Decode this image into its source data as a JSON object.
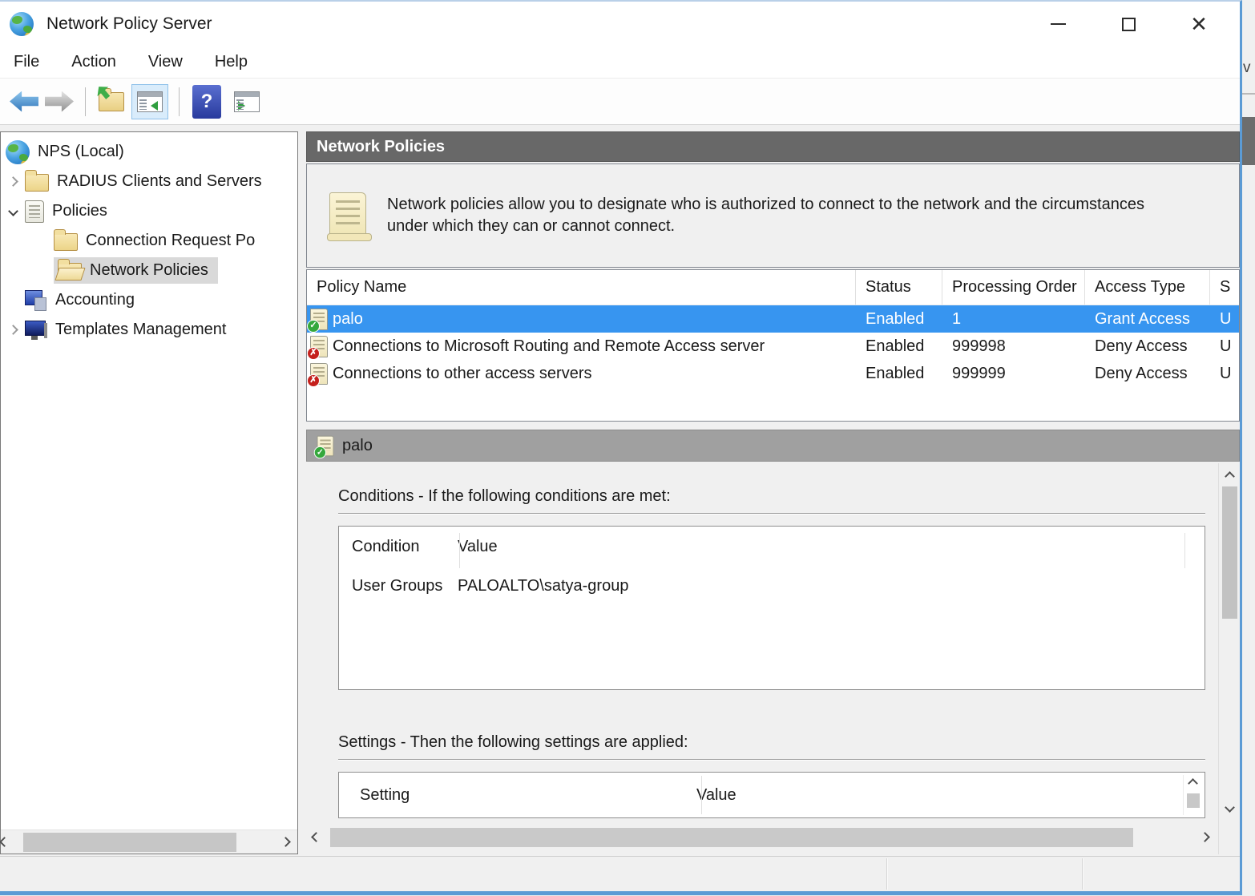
{
  "window": {
    "title": "Network Policy Server",
    "edge_fragment": "v"
  },
  "menu": {
    "items": [
      "File",
      "Action",
      "View",
      "Help"
    ]
  },
  "tree": {
    "items": [
      {
        "label": "NPS (Local)"
      },
      {
        "label": "RADIUS Clients and Servers"
      },
      {
        "label": "Policies"
      },
      {
        "label": "Connection Request Po"
      },
      {
        "label": "Network Policies"
      },
      {
        "label": "Accounting"
      },
      {
        "label": "Templates Management"
      }
    ]
  },
  "content": {
    "header_title": "Network Policies",
    "description": "Network policies allow you to designate who is authorized to connect to the network and the circumstances under which they can or cannot connect.",
    "policy_table": {
      "columns": {
        "name": "Policy Name",
        "status": "Status",
        "order": "Processing Order",
        "access": "Access Type",
        "source": "S"
      },
      "rows": [
        {
          "name": "palo",
          "status": "Enabled",
          "order": "1",
          "access": "Grant Access",
          "source": "U"
        },
        {
          "name": "Connections to Microsoft Routing and Remote Access server",
          "status": "Enabled",
          "order": "999998",
          "access": "Deny Access",
          "source": "U"
        },
        {
          "name": "Connections to other access servers",
          "status": "Enabled",
          "order": "999999",
          "access": "Deny Access",
          "source": "U"
        }
      ]
    },
    "detail": {
      "title": "palo",
      "conditions_heading": "Conditions - If the following conditions are met:",
      "conditions_columns": {
        "condition": "Condition",
        "value": "Value"
      },
      "conditions_rows": [
        {
          "condition": "User Groups",
          "value": "PALOALTO\\satya-group"
        }
      ],
      "settings_heading": "Settings - Then the following settings are applied:",
      "settings_columns": {
        "setting": "Setting",
        "value": "Value"
      }
    }
  },
  "colors": {
    "selection_blue": "#3795f0",
    "header_gray": "#686868",
    "detail_bar_gray": "#a0a0a0",
    "window_border_blue": "#5b9bd5"
  }
}
